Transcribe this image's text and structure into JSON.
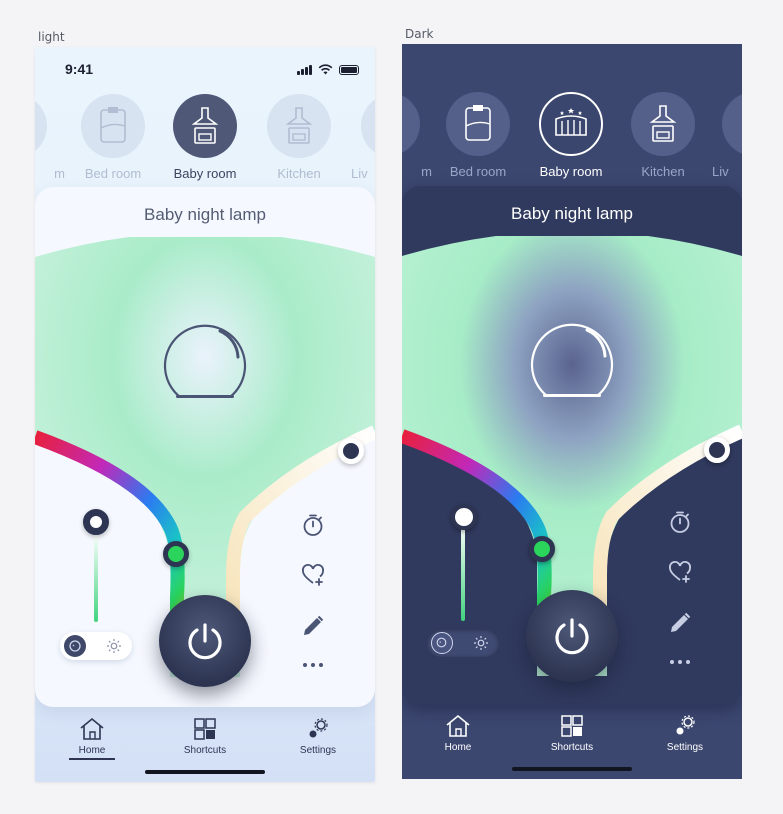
{
  "canvas": {
    "light_label": "light",
    "dark_label": "Dark"
  },
  "status_bar": {
    "time": "9:41"
  },
  "rooms": [
    {
      "label": "m",
      "icon": "living-room-partial-icon"
    },
    {
      "label": "Bed room",
      "icon": "bed-icon"
    },
    {
      "label": "Baby room",
      "icon": "crib-icon",
      "active": true
    },
    {
      "label": "Kitchen",
      "icon": "kitchen-stove-icon"
    },
    {
      "label": "Liv",
      "icon": "living-room-icon"
    }
  ],
  "device": {
    "title": "Baby night lamp",
    "icon": "night-lamp-icon",
    "color_slider_colors": [
      "#e8203d",
      "#8b37e8",
      "#2b7bf0",
      "#19c7c4",
      "#2bd45a",
      "#f2c10a"
    ],
    "color_value": "#2bd45a",
    "glow_color": "#a6ecc7",
    "warm_color": "#fbebc6"
  },
  "side_actions": [
    {
      "name": "timer",
      "icon": "timer-icon"
    },
    {
      "name": "favorite",
      "icon": "heart-add-icon"
    },
    {
      "name": "edit",
      "icon": "pencil-icon"
    },
    {
      "name": "more",
      "icon": "more-dots-icon"
    }
  ],
  "mode_toggle": {
    "left_icon": "baby-mode-icon",
    "right_icon": "sun-icon",
    "selected": "left"
  },
  "power_button": {
    "icon": "power-icon",
    "state": "on"
  },
  "tabs": [
    {
      "label": "Home",
      "icon": "home-icon",
      "active": true
    },
    {
      "label": "Shortcuts",
      "icon": "shortcuts-grid-icon"
    },
    {
      "label": "Settings",
      "icon": "settings-gears-icon"
    }
  ],
  "colors": {
    "light_bg": "#e6f0fb",
    "dark_bg": "#3c4770",
    "dark_card": "#303a5e",
    "accent_dark": "#2d3552"
  }
}
